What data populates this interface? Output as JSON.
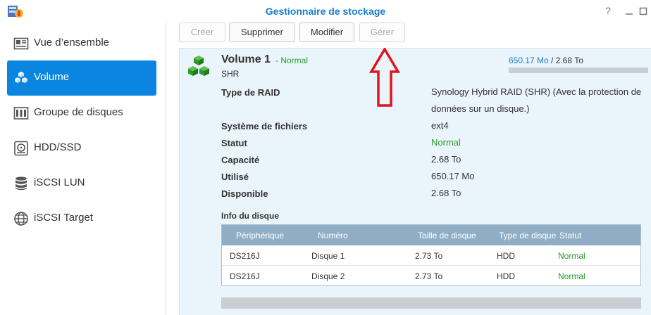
{
  "window": {
    "title": "Gestionnaire de stockage",
    "help_icon": "question-icon",
    "minimize_icon": "minimize-icon",
    "maximize_icon": "maximize-icon"
  },
  "sidebar": {
    "items": [
      {
        "label": "Vue d’ensemble",
        "icon": "overview-icon",
        "active": false
      },
      {
        "label": "Volume",
        "icon": "volume-cubes-icon",
        "active": true
      },
      {
        "label": "Groupe de disques",
        "icon": "disk-group-icon",
        "active": false
      },
      {
        "label": "HDD/SSD",
        "icon": "hdd-icon",
        "active": false
      },
      {
        "label": "iSCSI LUN",
        "icon": "database-icon",
        "active": false
      },
      {
        "label": "iSCSI Target",
        "icon": "globe-icon",
        "active": false
      }
    ]
  },
  "toolbar": {
    "create_label": "Créer",
    "delete_label": "Supprimer",
    "modify_label": "Modifier",
    "manage_label": "Gérer"
  },
  "volume": {
    "name": "Volume 1",
    "status": "- Normal",
    "raid_short": "SHR",
    "used_text": "650.17 Mo",
    "total_text": " / 2.68 To",
    "usage_fraction": 0.0002,
    "properties": [
      {
        "label": "Type de RAID",
        "value": "Synology Hybrid RAID (SHR) (Avec la protection de données sur un disque.)",
        "status": false
      },
      {
        "label": "Système de fichiers",
        "value": "ext4",
        "status": false
      },
      {
        "label": "Statut",
        "value": "Normal",
        "status": true
      },
      {
        "label": "Capacité",
        "value": "2.68 To",
        "status": false
      },
      {
        "label": "Utilisé",
        "value": "650.17 Mo",
        "status": false
      },
      {
        "label": "Disponible",
        "value": "2.68 To",
        "status": false
      }
    ]
  },
  "disk_info": {
    "title": "Info du disque",
    "columns": [
      "Périphérique",
      "Numéro",
      "Taille de disque",
      "Type de disque",
      "Statut"
    ],
    "rows": [
      [
        "DS216J",
        "Disque 1",
        "2.73 To",
        "HDD",
        "Normal"
      ],
      [
        "DS216J",
        "Disque 2",
        "2.73 To",
        "HDD",
        "Normal"
      ]
    ]
  },
  "colors": {
    "accent": "#0a86e0",
    "title_blue": "#1a7cc9",
    "status_green": "#2b9a2b",
    "annotation_red": "#e0141e"
  }
}
